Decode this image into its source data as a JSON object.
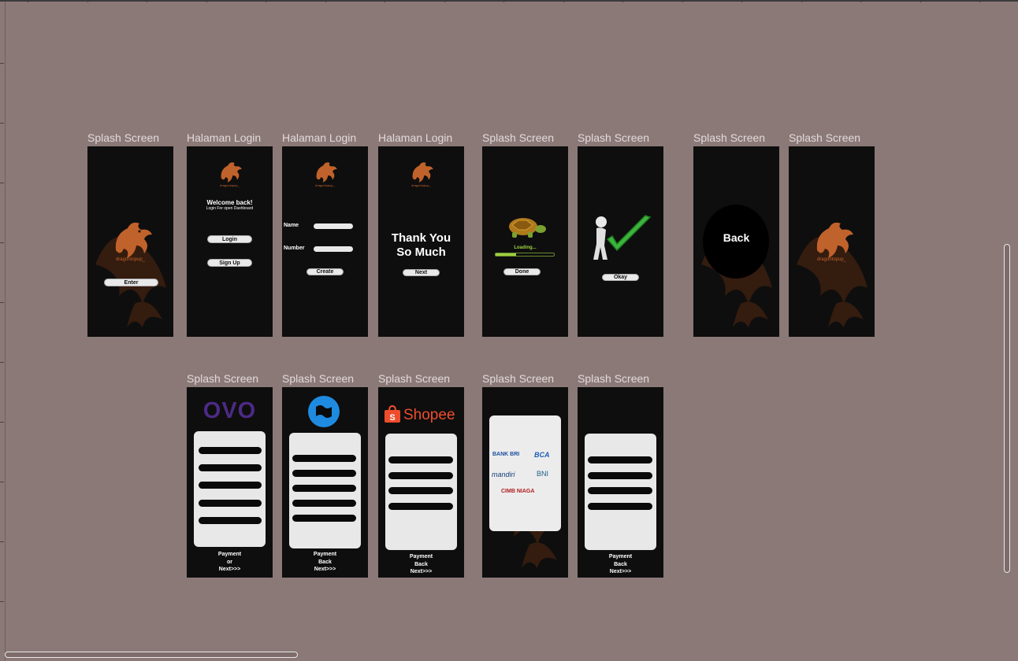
{
  "canvas": {
    "background": "#8b7978"
  },
  "row1": [
    {
      "label": "Splash Screen"
    },
    {
      "label": "Halaman Login"
    },
    {
      "label": "Halaman Login"
    },
    {
      "label": "Halaman Login"
    },
    {
      "label": "Splash Screen"
    },
    {
      "label": "Splash Screen"
    },
    {
      "label": "Splash Screen"
    },
    {
      "label": "Splash Screen"
    }
  ],
  "row2": [
    {
      "label": "Splash Screen"
    },
    {
      "label": "Splash Screen"
    },
    {
      "label": "Splash Screen"
    },
    {
      "label": "Splash Screen"
    },
    {
      "label": "Splash Screen"
    }
  ],
  "brand": {
    "name": "dragontopup_",
    "color": "#c0622b"
  },
  "splash1": {
    "button": "Enter"
  },
  "login1": {
    "title": "Welcome back!",
    "subtitle": "Login For open Dashboard",
    "login_btn": "Login",
    "signup_btn": "Sign Up"
  },
  "login2": {
    "name_label": "Name",
    "number_label": "Number",
    "create_btn": "Create"
  },
  "login3": {
    "heading_line1": "Thank You",
    "heading_line2": "So Much",
    "next_btn": "Next"
  },
  "loading": {
    "text": "Loading...",
    "progress": 0.35,
    "done_btn": "Done"
  },
  "success": {
    "okay_btn": "Okay"
  },
  "back_screen": {
    "text": "Back"
  },
  "payments": {
    "ovo": {
      "logo": "OVO",
      "lines": [
        "Payment",
        "or",
        "Next>>>"
      ]
    },
    "dana": {
      "lines": [
        "Payment",
        "Back",
        "Next>>>"
      ]
    },
    "shopee": {
      "logo": "Shopee",
      "lines": [
        "Payment",
        "Back",
        "Next>>>"
      ]
    },
    "banks": {
      "names": [
        "BANK BRI",
        "BCA",
        "mandiri",
        "BNI",
        "CIMB NIAGA"
      ]
    },
    "generic": {
      "lines": [
        "Payment",
        "Back",
        "Next>>>"
      ]
    }
  }
}
